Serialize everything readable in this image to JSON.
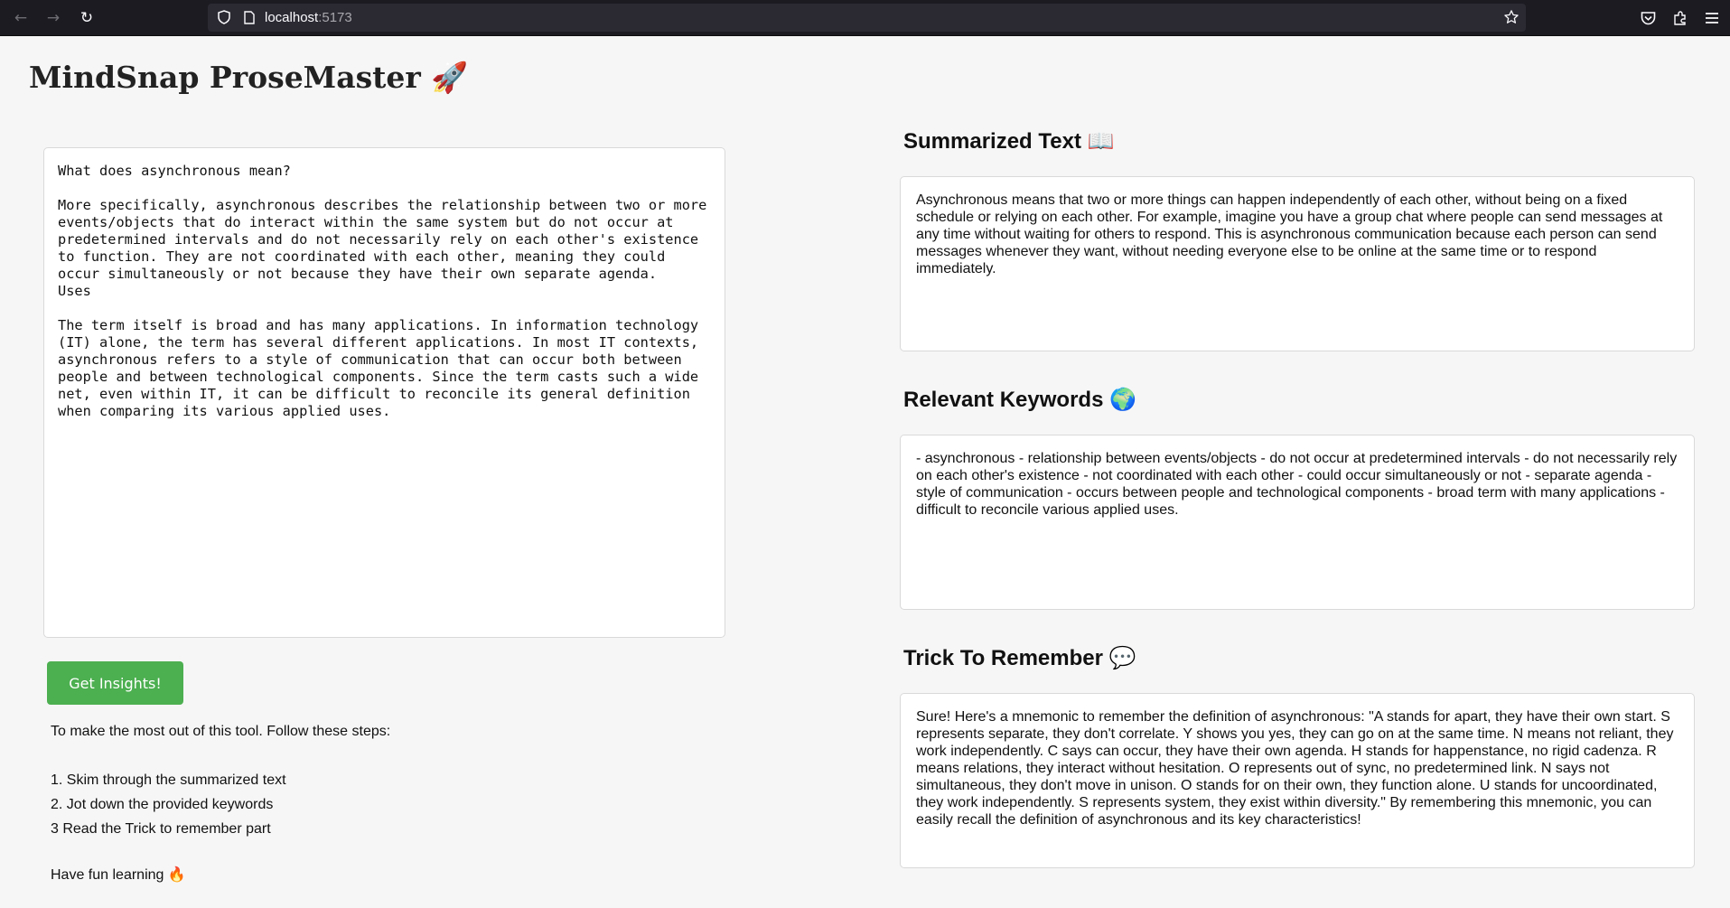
{
  "browser": {
    "back_icon": "←",
    "forward_icon": "→",
    "reload_icon": "↻",
    "url_host": "localhost",
    "url_port": ":5173"
  },
  "app": {
    "title": "MindSnap ProseMaster",
    "title_emoji": "🚀"
  },
  "input": {
    "text": "What does asynchronous mean?\n\nMore specifically, asynchronous describes the relationship between two or more events/objects that do interact within the same system but do not occur at predetermined intervals and do not necessarily rely on each other's existence to function. They are not coordinated with each other, meaning they could occur simultaneously or not because they have their own separate agenda.\nUses\n\nThe term itself is broad and has many applications. In information technology (IT) alone, the term has several different applications. In most IT contexts, asynchronous refers to a style of communication that can occur both between people and between technological components. Since the term casts such a wide net, even within IT, it can be difficult to reconcile its general definition when comparing its various applied uses."
  },
  "button": {
    "label": "Get Insights!"
  },
  "instructions": {
    "intro": "To make the most out of this tool. Follow these steps:",
    "step1": "1. Skim through the summarized text",
    "step2": "2. Jot down the provided keywords",
    "step3": "3 Read the Trick to remember part",
    "outro": "Have fun learning",
    "outro_emoji": "🔥"
  },
  "summary": {
    "heading": "Summarized Text",
    "heading_emoji": "📖",
    "text": "Asynchronous means that two or more things can happen independently of each other, without being on a fixed schedule or relying on each other. For example, imagine you have a group chat where people can send messages at any time without waiting for others to respond. This is asynchronous communication because each person can send messages whenever they want, without needing everyone else to be online at the same time or to respond immediately."
  },
  "keywords": {
    "heading": "Relevant Keywords",
    "heading_emoji": "🌍",
    "text": "- asynchronous - relationship between events/objects - do not occur at predetermined intervals - do not necessarily rely on each other's existence - not coordinated with each other - could occur simultaneously or not - separate agenda - style of communication - occurs between people and technological components - broad term with many applications - difficult to reconcile various applied uses."
  },
  "trick": {
    "heading": "Trick To Remember",
    "heading_emoji": "💬",
    "text": "Sure! Here's a mnemonic to remember the definition of asynchronous: \"A stands for apart, they have their own start. S represents separate, they don't correlate. Y shows you yes, they can go on at the same time. N means not reliant, they work independently. C says can occur, they have their own agenda. H stands for happenstance, no rigid cadenza. R means relations, they interact without hesitation. O represents out of sync, no predetermined link. N says not simultaneous, they don't move in unison. O stands for on their own, they function alone. U stands for uncoordinated, they work independently. S represents system, they exist within diversity.\" By remembering this mnemonic, you can easily recall the definition of asynchronous and its key characteristics!"
  },
  "colors": {
    "accent_button": "#4caf50",
    "page_background": "#f6f6f6",
    "browser_chrome": "#1c1b22"
  }
}
